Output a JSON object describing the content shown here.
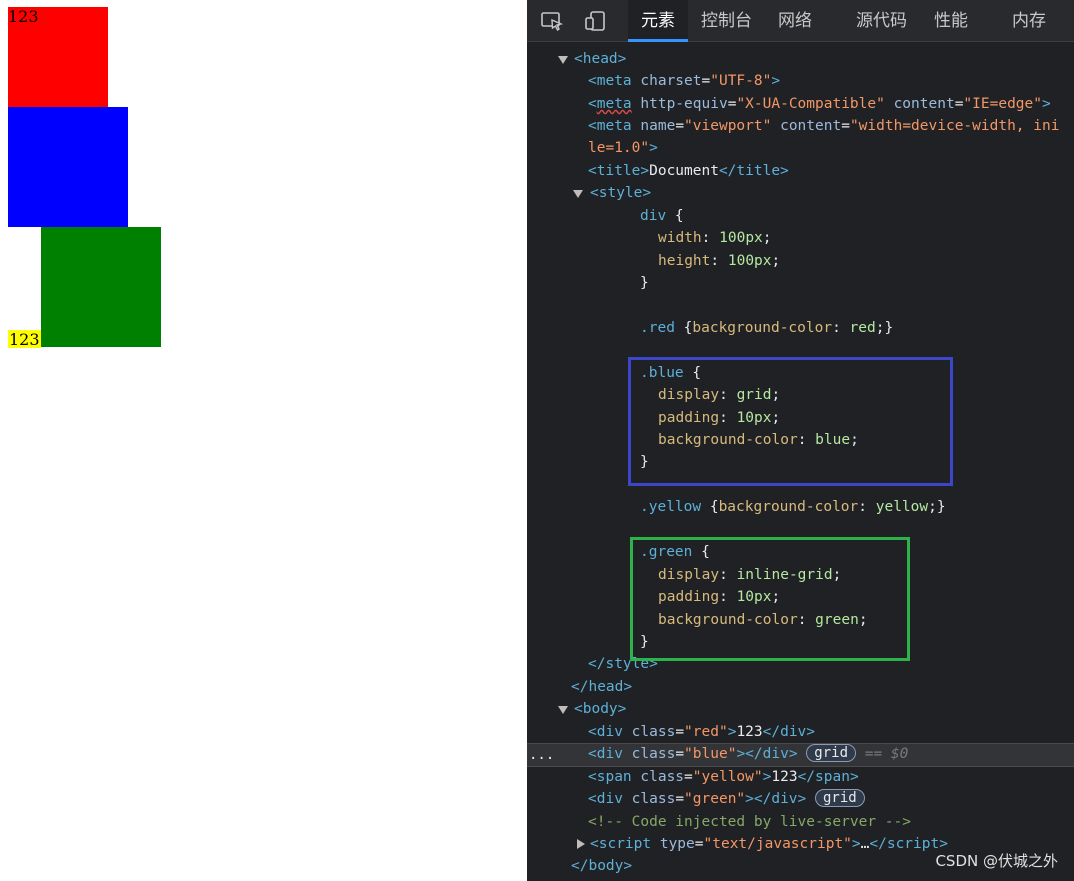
{
  "page": {
    "red_text": "123",
    "yellow_text": "123",
    "colors": {
      "red": "#ff0000",
      "blue": "#0000ff",
      "green": "#008000",
      "yellow": "#ffff00"
    }
  },
  "devtools": {
    "toolbar_icons": [
      "inspect-icon",
      "device-toggle-icon"
    ],
    "tabs": [
      "元素",
      "控制台",
      "网络",
      "源代码",
      "性能",
      "内存"
    ],
    "active_tab": "元素",
    "code": {
      "head_open": "<head>",
      "meta1": {
        "tag": "meta",
        "attr1": "charset",
        "val1": "\"UTF-8\""
      },
      "meta2": {
        "tag": "meta",
        "attr1": "http-equiv",
        "val1": "\"X-UA-Compatible\"",
        "attr2": "content",
        "val2": "\"IE=edge\""
      },
      "meta3": {
        "tag": "meta",
        "attr1": "name",
        "val1": "\"viewport\"",
        "attr2": "content",
        "val2": "\"width=device-width, ini",
        "cont": "le=1.0\""
      },
      "title_text": "Document",
      "style_open": "<style>",
      "css_div_sel": "div",
      "css_width_prop": "width",
      "css_width_val": "100px",
      "css_height_prop": "height",
      "css_height_val": "100px",
      "css_red_sel": ".red",
      "css_red_prop": "background-color",
      "css_red_val": "red",
      "css_blue_sel": ".blue",
      "css_display_prop": "display",
      "css_blue_display": "grid",
      "css_padding_prop": "padding",
      "css_padding_val": "10px",
      "css_bg_prop": "background-color",
      "css_blue_bg": "blue",
      "css_yellow_sel": ".yellow",
      "css_yellow_val": "yellow",
      "css_green_sel": ".green",
      "css_green_display": "inline-grid",
      "css_green_bg": "green",
      "style_close": "</style>",
      "head_close": "</head>",
      "body_open": "<body>",
      "div_red": {
        "class": "\"red\"",
        "text": "123"
      },
      "div_blue": {
        "class": "\"blue\""
      },
      "span_yellow": {
        "class": "\"yellow\"",
        "text": "123"
      },
      "div_green": {
        "class": "\"green\""
      },
      "comment": "<!-- Code injected by live-server -->",
      "script_line": {
        "attr": "type",
        "val": "\"text/javascript\"",
        "ellipsis": "…"
      },
      "body_close": "</body>"
    },
    "grid_badge": "grid",
    "selected_marker": "== $0",
    "dots": "..."
  },
  "watermark": "CSDN @伏城之外"
}
